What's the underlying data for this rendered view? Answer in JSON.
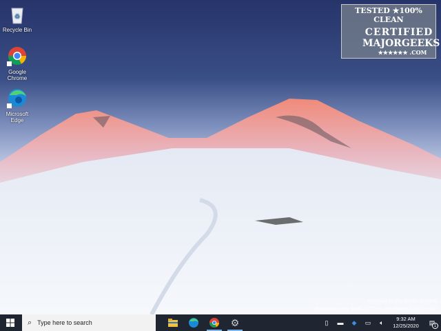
{
  "desktop": {
    "icons": [
      {
        "label": "Recycle Bin"
      },
      {
        "label": "Google Chrome"
      },
      {
        "label": "Microsoft Edge"
      }
    ]
  },
  "watermark": {
    "line1": "Windows 10 Pro Insider Preview",
    "line2": "Evaluation copy. Build 21277.rs_prerelease.201211-1453"
  },
  "stamp": {
    "line1": "TESTED ★100% CLEAN",
    "line2": "CERTIFIED",
    "line3": "MAJORGEEKS",
    "line4": "★★★★★★ .COM"
  },
  "taskbar": {
    "search_placeholder": "Type here to search",
    "apps": [
      "File Explorer",
      "Microsoft Edge",
      "Google Chrome",
      "Settings"
    ],
    "time": "9:32 AM",
    "date": "12/25/2020",
    "notification_count": "1"
  }
}
